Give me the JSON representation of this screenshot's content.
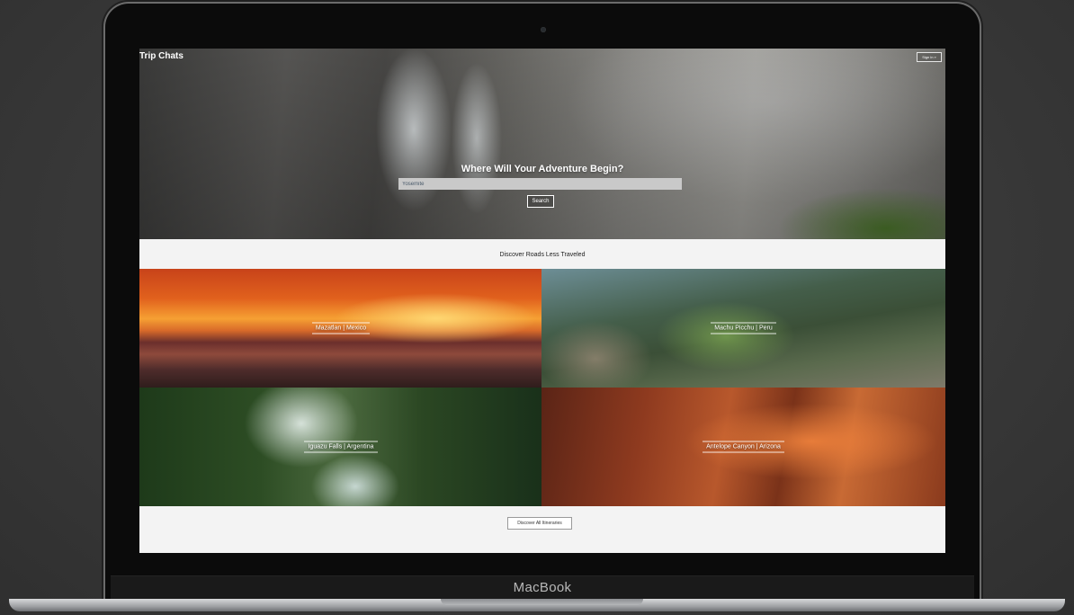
{
  "device": {
    "brand_label": "MacBook"
  },
  "header": {
    "title": "Trip Chats",
    "signin_label": "Sign in »"
  },
  "hero": {
    "heading": "Where Will Your Adventure Begin?",
    "search_value": "Yosemite",
    "search_button": "Search"
  },
  "section": {
    "title": "Discover Roads Less Traveled"
  },
  "destinations": [
    {
      "label": "Mazatlan | Mexico"
    },
    {
      "label": "Machu Picchu | Peru"
    },
    {
      "label": "Iguazu Falls | Argentina"
    },
    {
      "label": "Antelope Canyon | Arizona"
    }
  ],
  "footer": {
    "discover_button": "Discover All Itineraries"
  }
}
